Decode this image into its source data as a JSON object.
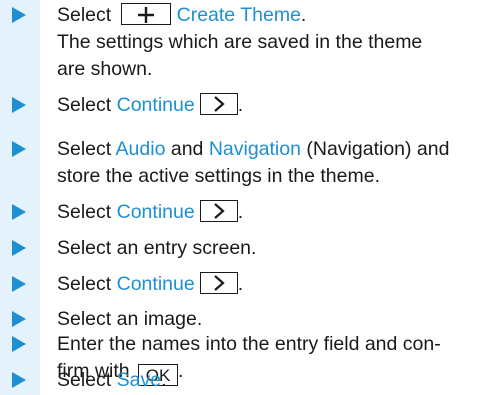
{
  "steps": [
    {
      "prefix": "Select",
      "link": "Create Theme",
      "suffix": ".",
      "line2": "The settings which are saved in the theme",
      "line3": "are shown."
    },
    {
      "prefix": "Select",
      "link": "Continue",
      "suffix": "."
    },
    {
      "prefix": "Select",
      "link1": "Audio",
      "mid": "and",
      "link2": "Navigation",
      "suffix": "(Navigation) and",
      "line2": "store the active settings in the theme."
    },
    {
      "prefix": "Select",
      "link": "Continue",
      "suffix": "."
    },
    {
      "text": "Select an entry screen."
    },
    {
      "prefix": "Select",
      "link": "Continue",
      "suffix": "."
    },
    {
      "text": "Select an image."
    },
    {
      "line1": "Enter the names into the entry field and con-",
      "line2_prefix": "firm with",
      "key": "OK",
      "suffix": "."
    },
    {
      "prefix": "Select",
      "link": "Save",
      "suffix": "."
    }
  ],
  "icons": {
    "bullet": "triangle-right-icon",
    "add": "plus-icon",
    "next": "chevron-right-icon"
  },
  "colors": {
    "accent": "#1e8fd0",
    "sidebar": "#e3f2fb",
    "text": "#1a1a1a"
  }
}
